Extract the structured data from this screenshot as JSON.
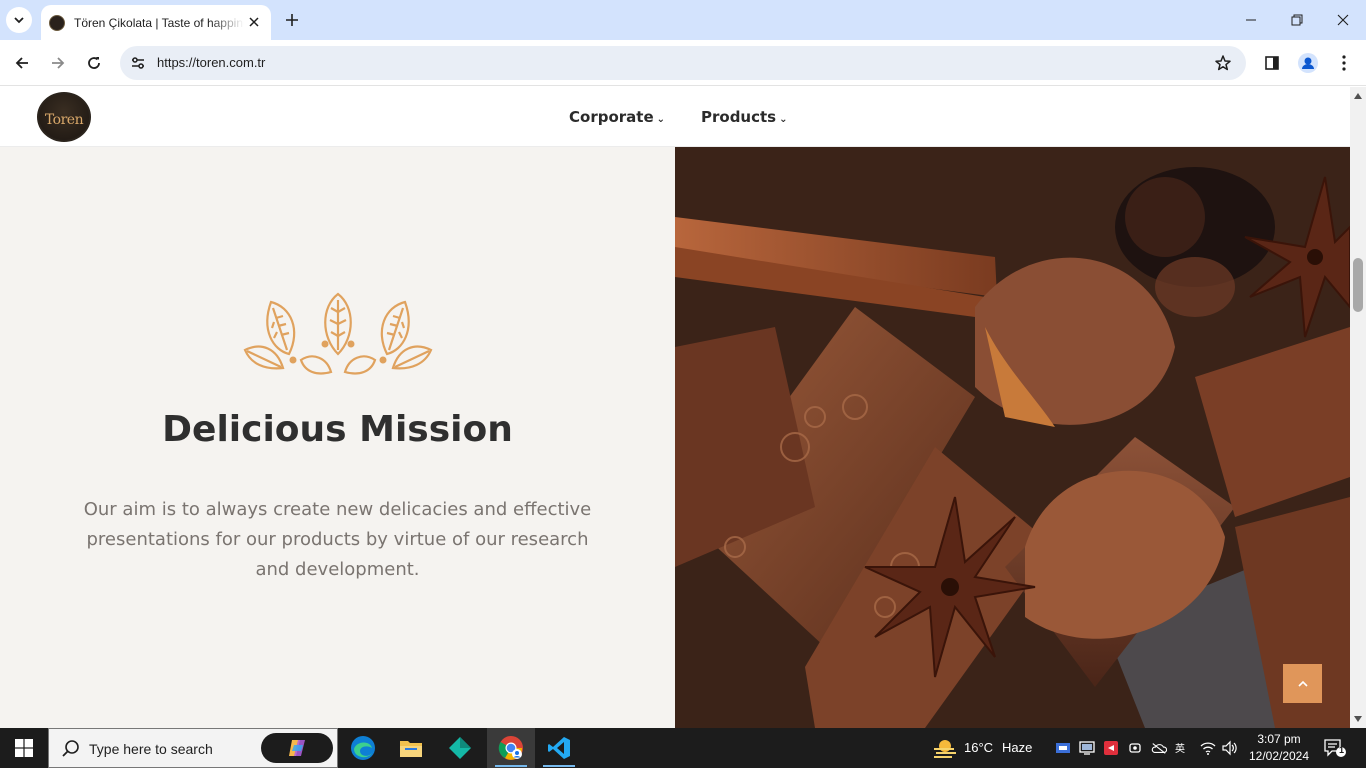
{
  "browser": {
    "tab_title": "Tören Çikolata | Taste of happiness",
    "url": "https://toren.com.tr"
  },
  "site": {
    "logo_text": "Toren",
    "nav": [
      {
        "label": "Corporate"
      },
      {
        "label": "Products"
      }
    ]
  },
  "mission": {
    "title": "Delicious Mission",
    "text": "Our aim is to always create new delicacies and effective presentations for our products by virtue of our research and development."
  },
  "taskbar": {
    "search_placeholder": "Type here to search",
    "weather_temp": "16°C",
    "weather_desc": "Haze",
    "time": "3:07 pm",
    "date": "12/02/2024",
    "notification_count": "1"
  },
  "colors": {
    "accent": "#e0965a",
    "ornament": "#e0a25e",
    "page_bg": "#f5f3f0",
    "title": "#2f2f2f",
    "body_text": "#7a7470"
  }
}
